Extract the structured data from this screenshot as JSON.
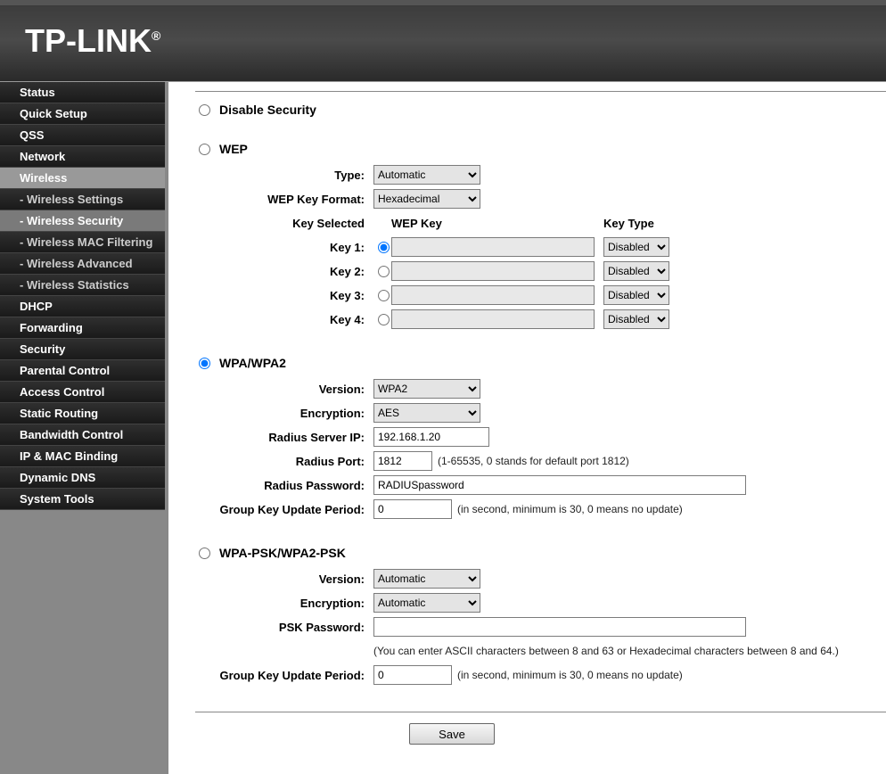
{
  "brand": "TP-LINK",
  "nav": [
    {
      "label": "Status",
      "type": "item"
    },
    {
      "label": "Quick Setup",
      "type": "item"
    },
    {
      "label": "QSS",
      "type": "item"
    },
    {
      "label": "Network",
      "type": "item"
    },
    {
      "label": "Wireless",
      "type": "item",
      "active": true
    },
    {
      "label": "- Wireless Settings",
      "type": "sub"
    },
    {
      "label": "- Wireless Security",
      "type": "sub",
      "current": true
    },
    {
      "label": "- Wireless MAC Filtering",
      "type": "sub"
    },
    {
      "label": "- Wireless Advanced",
      "type": "sub"
    },
    {
      "label": "- Wireless Statistics",
      "type": "sub"
    },
    {
      "label": "DHCP",
      "type": "item"
    },
    {
      "label": "Forwarding",
      "type": "item"
    },
    {
      "label": "Security",
      "type": "item"
    },
    {
      "label": "Parental Control",
      "type": "item"
    },
    {
      "label": "Access Control",
      "type": "item"
    },
    {
      "label": "Static Routing",
      "type": "item"
    },
    {
      "label": "Bandwidth Control",
      "type": "item"
    },
    {
      "label": "IP & MAC Binding",
      "type": "item"
    },
    {
      "label": "Dynamic DNS",
      "type": "item"
    },
    {
      "label": "System Tools",
      "type": "item"
    }
  ],
  "security_mode": "wpa",
  "disable": {
    "title": "Disable Security"
  },
  "wep": {
    "title": "WEP",
    "labels": {
      "type": "Type:",
      "format": "WEP Key Format:",
      "key_selected": "Key Selected",
      "wep_key": "WEP Key",
      "key_type": "Key Type",
      "k1": "Key 1:",
      "k2": "Key 2:",
      "k3": "Key 3:",
      "k4": "Key 4:"
    },
    "type": "Automatic",
    "format": "Hexadecimal",
    "selected_key": "1",
    "keys": [
      "",
      "",
      "",
      ""
    ],
    "key_types": [
      "Disabled",
      "Disabled",
      "Disabled",
      "Disabled"
    ]
  },
  "wpa": {
    "title": "WPA/WPA2",
    "labels": {
      "version": "Version:",
      "encryption": "Encryption:",
      "server": "Radius Server IP:",
      "port": "Radius Port:",
      "password": "Radius Password:",
      "gk": "Group Key Update Period:"
    },
    "version": "WPA2",
    "encryption": "AES",
    "server": "192.168.1.20",
    "port": "1812",
    "port_hint": "(1-65535, 0 stands for default port 1812)",
    "password": "RADIUSpassword",
    "gk": "0",
    "gk_hint": "(in second, minimum is 30, 0 means no update)"
  },
  "psk": {
    "title": "WPA-PSK/WPA2-PSK",
    "labels": {
      "version": "Version:",
      "encryption": "Encryption:",
      "password": "PSK Password:",
      "gk": "Group Key Update Period:"
    },
    "version": "Automatic",
    "encryption": "Automatic",
    "password": "",
    "password_hint": "(You can enter ASCII characters between 8 and 63 or Hexadecimal characters between 8 and 64.)",
    "gk": "0",
    "gk_hint": "(in second, minimum is 30, 0 means no update)"
  },
  "save_label": "Save"
}
